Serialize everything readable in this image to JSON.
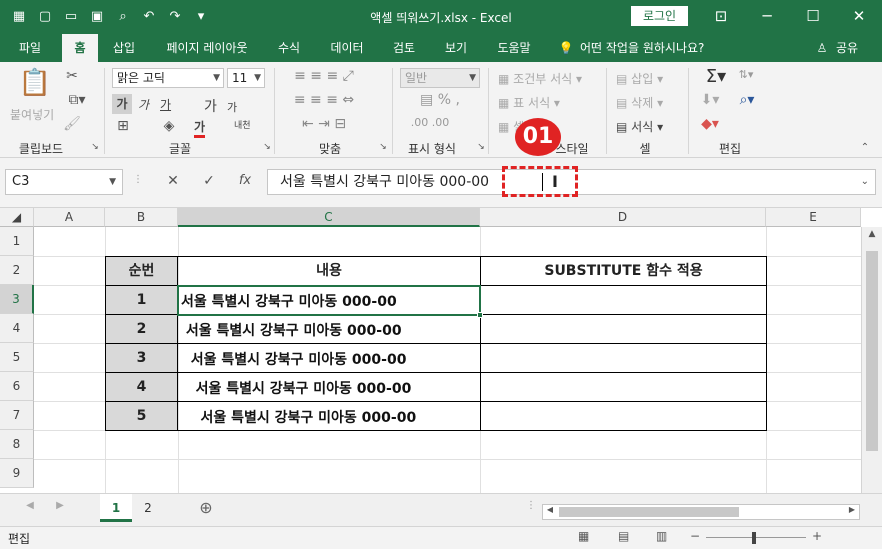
{
  "window": {
    "title": "액셀 띄워쓰기.xlsx  -  Excel",
    "login_label": "로그인"
  },
  "tabs": [
    "파일",
    "홈",
    "삽입",
    "페이지 레이아웃",
    "수식",
    "데이터",
    "검토",
    "보기",
    "도움말"
  ],
  "active_tab": "홈",
  "tell_me": "어떤 작업을 원하시나요?",
  "share": "공유",
  "ribbon": {
    "clipboard": {
      "paste": "붙여넣기",
      "label": "클립보드"
    },
    "font": {
      "name": "맑은 고딕",
      "size": "11",
      "label": "글꼴",
      "bold": "가",
      "italic": "가",
      "underline": "가",
      "grow": "가",
      "shrink": "가",
      "color": "가",
      "phonetic": "내천"
    },
    "alignment": {
      "label": "맞춤"
    },
    "number": {
      "format": "일반",
      "label": "표시 형식"
    },
    "styles": {
      "conditional": "조건부 서식",
      "table": "표 서식",
      "cell_styles": "셀",
      "label": "스타일"
    },
    "cells": {
      "insert": "삽입",
      "delete": "삭제",
      "format": "서식",
      "label": "셀"
    },
    "editing": {
      "label": "편집"
    }
  },
  "formula_bar": {
    "name_box": "C3",
    "content": "서울 특별시 강북구 미아동 000-00"
  },
  "badge": "01",
  "columns": [
    "A",
    "B",
    "C",
    "D",
    "E"
  ],
  "rows": [
    "1",
    "2",
    "3",
    "4",
    "5",
    "6",
    "7",
    "8",
    "9"
  ],
  "table": {
    "headers": [
      "순번",
      "내용",
      "SUBSTITUTE 함수 적용"
    ],
    "rows": [
      {
        "seq": "1",
        "content": "서울 특별시 강북구 미아동 000-00"
      },
      {
        "seq": "2",
        "content": " 서울 특별시 강북구 미아동 000-00"
      },
      {
        "seq": "3",
        "content": "  서울 특별시 강북구 미아동 000-00"
      },
      {
        "seq": "4",
        "content": "   서울 특별시 강북구 미아동 000-00"
      },
      {
        "seq": "5",
        "content": "    서울 특별시 강북구 미아동 000-00"
      }
    ]
  },
  "sheets": [
    "1",
    "2"
  ],
  "active_sheet": "1",
  "status": {
    "mode": "편집"
  },
  "colors": {
    "accent": "#217346",
    "badge": "#e02323"
  }
}
